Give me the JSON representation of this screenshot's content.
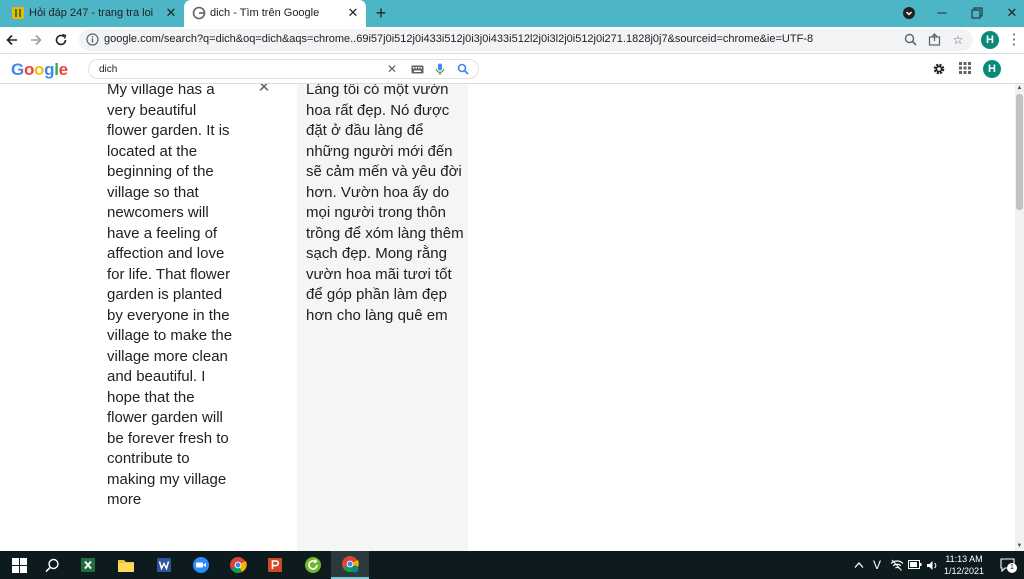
{
  "browser": {
    "tabs": [
      {
        "title": "Hỏi đáp 247 - trang tra loi",
        "active": false
      },
      {
        "title": "dich - Tìm trên Google",
        "active": true
      }
    ],
    "new_tab_label": "+",
    "url": "google.com/search?q=dich&oq=dich&aqs=chrome..69i57j0i512j0i433i512j0i3j0i433i512l2j0i3l2j0i512j0i271.1828j0j7&sourceid=chrome&ie=UTF-8",
    "profile_initial": "H"
  },
  "google": {
    "logo_letters": [
      "G",
      "o",
      "o",
      "g",
      "l",
      "e"
    ],
    "search_value": "dich",
    "profile_initial": "H"
  },
  "translate": {
    "source_text": "My village has a very beautiful flower garden. It is located at the beginning of the village so that newcomers will have a feeling of affection and love for life. That flower garden is planted by everyone in the village to make the village more clean and beautiful. I hope that the flower garden will be forever fresh to contribute to making my village more",
    "target_text": "Làng tôi có một vườn hoa rất đẹp. Nó được đặt ở đầu làng để những người mới đến sẽ cảm mến và yêu đời hơn. Vườn hoa ấy do mọi người trong thôn trồng để xóm làng thêm sạch đẹp. Mong rằng vườn hoa mãi tươi tốt để góp phần làm đẹp hơn cho làng quê em"
  },
  "taskbar": {
    "lang_indicator": "V",
    "time": "11:13 AM",
    "date": "1/12/2021",
    "notification_count": "1"
  },
  "colors": {
    "tabbar_bg": "#4db6c6",
    "google_blue": "#4285f4",
    "google_red": "#ea4335",
    "google_yellow": "#fbbc05",
    "google_green": "#34a853",
    "avatar_bg": "#0a8a79",
    "taskbar_bg": "#0d1b1e"
  }
}
